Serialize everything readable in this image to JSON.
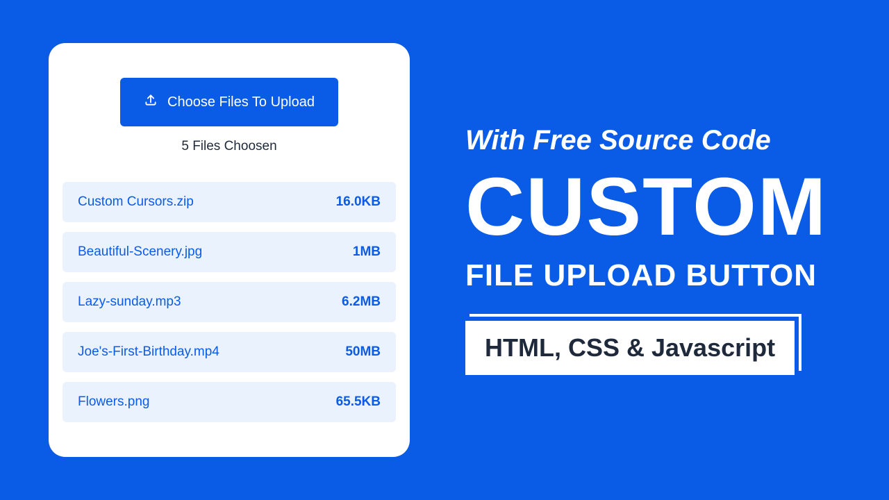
{
  "card": {
    "choose_label": "Choose Files To Upload",
    "count_text": "5 Files Choosen",
    "files": [
      {
        "name": "Custom Cursors.zip",
        "size": "16.0KB"
      },
      {
        "name": "Beautiful-Scenery.jpg",
        "size": "1MB"
      },
      {
        "name": "Lazy-sunday.mp3",
        "size": "6.2MB"
      },
      {
        "name": "Joe's-First-Birthday.mp4",
        "size": "50MB"
      },
      {
        "name": "Flowers.png",
        "size": "65.5KB"
      }
    ]
  },
  "promo": {
    "subtitle": "With Free Source Code",
    "title": "CUSTOM",
    "subtitle2": "FILE UPLOAD BUTTON",
    "tech": "HTML, CSS & Javascript"
  },
  "colors": {
    "bg": "#0a5be6",
    "card_bg": "#ffffff",
    "row_bg": "#eaf2fe",
    "text_blue": "#0a5be6",
    "text_dark": "#1e293b"
  }
}
